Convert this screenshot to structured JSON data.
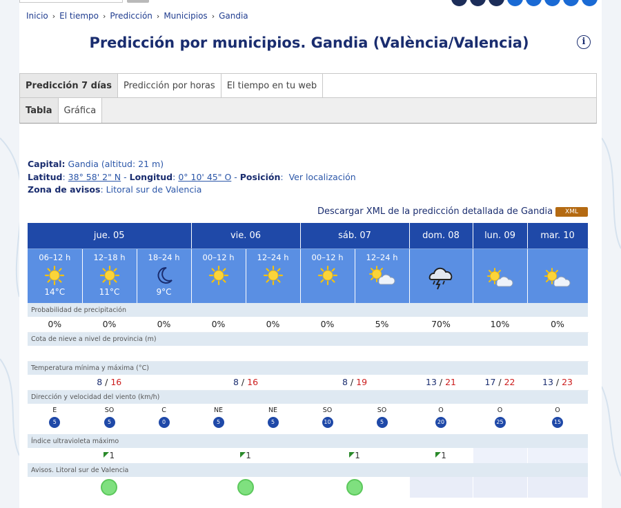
{
  "breadcrumb": [
    "Inicio",
    "El tiempo",
    "Predicción",
    "Municipios",
    "Gandia"
  ],
  "title": "Predicción por municipios. Gandia (València/Valencia)",
  "tabs_main": [
    "Predicción 7 días",
    "Predicción por horas",
    "El tiempo en tu web"
  ],
  "tabs_sub": [
    "Tabla",
    "Gráfica"
  ],
  "info": {
    "capital_label": "Capital:",
    "capital_value": "Gandia (altitud: 21 m)",
    "lat_label": "Latitud",
    "lat_value": "38° 58' 2\" N",
    "lon_label": "Longitud",
    "lon_value": "0° 10' 45\" O",
    "pos_label": "Posición",
    "pos_value": "Ver localización",
    "zona_label": "Zona de avisos",
    "zona_value": "Litoral sur de Valencia"
  },
  "download": {
    "text": "Descargar XML de la predicción detallada de Gandia",
    "button": "XML"
  },
  "days": [
    {
      "label": "jue. 05",
      "span": 3
    },
    {
      "label": "vie. 06",
      "span": 2
    },
    {
      "label": "sáb. 07",
      "span": 2
    },
    {
      "label": "dom. 08",
      "span": 1
    },
    {
      "label": "lun. 09",
      "span": 1
    },
    {
      "label": "mar. 10",
      "span": 1
    }
  ],
  "periods": [
    {
      "label": "06–12 h",
      "icon": "sun-icon",
      "temp": "14°C"
    },
    {
      "label": "12–18 h",
      "icon": "sun-icon",
      "temp": "11°C"
    },
    {
      "label": "18–24 h",
      "icon": "moon-icon",
      "temp": "9°C"
    },
    {
      "label": "00–12 h",
      "icon": "sun-icon",
      "temp": ""
    },
    {
      "label": "12–24 h",
      "icon": "sun-icon",
      "temp": ""
    },
    {
      "label": "00–12 h",
      "icon": "sun-icon",
      "temp": ""
    },
    {
      "label": "12–24 h",
      "icon": "sun-cloud-icon",
      "temp": ""
    },
    {
      "label": "",
      "icon": "storm-cloud-icon",
      "temp": ""
    },
    {
      "label": "",
      "icon": "sun-cloud-icon",
      "temp": ""
    },
    {
      "label": "",
      "icon": "sun-cloud-icon",
      "temp": ""
    }
  ],
  "labels": {
    "precip": "Probabilidad de precipitación",
    "snow": "Cota de nieve a nivel de provincia (m)",
    "temp": "Temperatura mínima y máxima (°C)",
    "wind": "Dirección y velocidad del viento (km/h)",
    "uv": "Índice ultravioleta máximo",
    "alerts": "Avisos. Litoral sur de Valencia"
  },
  "precip": [
    "0%",
    "0%",
    "0%",
    "0%",
    "0%",
    "0%",
    "5%",
    "70%",
    "10%",
    "0%"
  ],
  "temps": [
    {
      "min": "8",
      "max": "16"
    },
    {
      "min": "8",
      "max": "16"
    },
    {
      "min": "8",
      "max": "19"
    },
    {
      "min": "13",
      "max": "21"
    },
    {
      "min": "17",
      "max": "22"
    },
    {
      "min": "13",
      "max": "23"
    }
  ],
  "wind": [
    {
      "dir": "E",
      "speed": "5"
    },
    {
      "dir": "SO",
      "speed": "5"
    },
    {
      "dir": "C",
      "speed": "0"
    },
    {
      "dir": "NE",
      "speed": "5"
    },
    {
      "dir": "NE",
      "speed": "5"
    },
    {
      "dir": "SO",
      "speed": "10"
    },
    {
      "dir": "SO",
      "speed": "5"
    },
    {
      "dir": "O",
      "speed": "20"
    },
    {
      "dir": "O",
      "speed": "25"
    },
    {
      "dir": "O",
      "speed": "15"
    }
  ],
  "uv": [
    "1",
    "1",
    "1",
    "1",
    "",
    ""
  ],
  "colors": {
    "header": "#1f49a8",
    "period": "#5a8fe3",
    "label_bg": "#dfe9f2",
    "tmax": "#cc1b1b",
    "alert_green": "#7fe07f"
  }
}
